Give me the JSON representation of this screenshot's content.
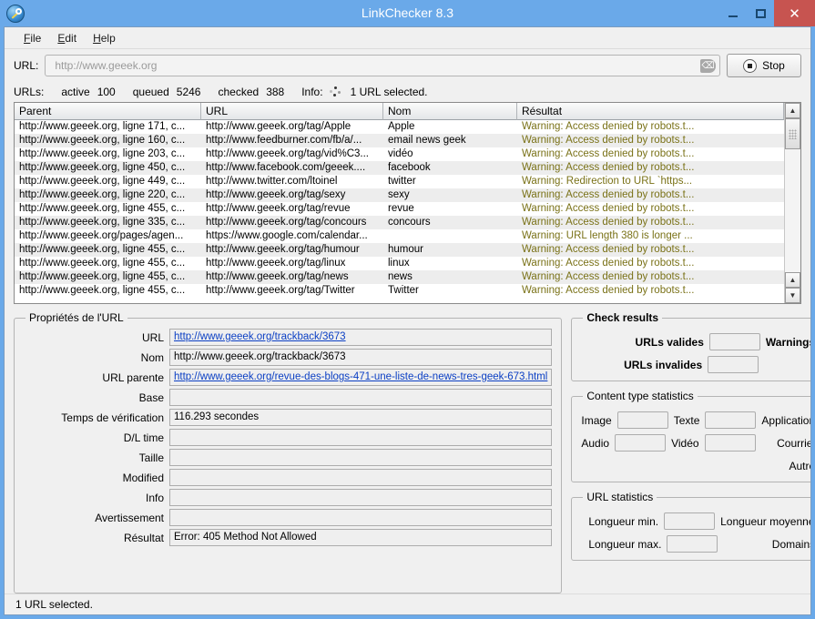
{
  "window": {
    "title": "LinkChecker 8.3",
    "app_icon": "linkchecker-icon",
    "minimize": "–",
    "maximize": "□",
    "close": "✕"
  },
  "menu": [
    {
      "pre": "",
      "mn": "F",
      "post": "ile"
    },
    {
      "pre": "",
      "mn": "E",
      "post": "dit"
    },
    {
      "pre": "",
      "mn": "H",
      "post": "elp"
    }
  ],
  "toolbar": {
    "url_label": "URL:",
    "url_value": "",
    "url_placeholder": "http://www.geeek.org",
    "clear_icon": "⌫",
    "stop_label": "Stop"
  },
  "counters": {
    "urls_label": "URLs:",
    "active_label": "active",
    "active_value": "100",
    "queued_label": "queued",
    "queued_value": "5246",
    "checked_label": "checked",
    "checked_value": "388",
    "info_label": "Info:",
    "info_value": "1 URL selected."
  },
  "table": {
    "columns": [
      "Parent",
      "URL",
      "Nom",
      "Résultat"
    ],
    "rows": [
      [
        "http://www.geeek.org, ligne 171, c...",
        "http://www.geeek.org/tag/Apple",
        "Apple",
        "Warning: Access denied by robots.t..."
      ],
      [
        "http://www.geeek.org, ligne 160, c...",
        "http://www.feedburner.com/fb/a/...",
        "email news geek",
        "Warning: Access denied by robots.t..."
      ],
      [
        "http://www.geeek.org, ligne 203, c...",
        "http://www.geeek.org/tag/vid%C3...",
        "vidéo",
        "Warning: Access denied by robots.t..."
      ],
      [
        "http://www.geeek.org, ligne 450, c...",
        "http://www.facebook.com/geeek....",
        "facebook",
        "Warning: Access denied by robots.t..."
      ],
      [
        "http://www.geeek.org, ligne 449, c...",
        "http://www.twitter.com/ltoinel",
        "twitter",
        "Warning: Redirection to URL `https..."
      ],
      [
        "http://www.geeek.org, ligne 220, c...",
        "http://www.geeek.org/tag/sexy",
        "sexy",
        "Warning: Access denied by robots.t..."
      ],
      [
        "http://www.geeek.org, ligne 455, c...",
        "http://www.geeek.org/tag/revue",
        "revue",
        "Warning: Access denied by robots.t..."
      ],
      [
        "http://www.geeek.org, ligne 335, c...",
        "http://www.geeek.org/tag/concours",
        "concours",
        "Warning: Access denied by robots.t..."
      ],
      [
        "http://www.geeek.org/pages/agen...",
        "https://www.google.com/calendar...",
        "",
        "Warning: URL length 380 is longer ..."
      ],
      [
        "http://www.geeek.org, ligne 455, c...",
        "http://www.geeek.org/tag/humour",
        "humour",
        "Warning: Access denied by robots.t..."
      ],
      [
        "http://www.geeek.org, ligne 455, c...",
        "http://www.geeek.org/tag/linux",
        "linux",
        "Warning: Access denied by robots.t..."
      ],
      [
        "http://www.geeek.org, ligne 455, c...",
        "http://www.geeek.org/tag/news",
        "news",
        "Warning: Access denied by robots.t..."
      ],
      [
        "http://www.geeek.org, ligne 455, c...",
        "http://www.geeek.org/tag/Twitter",
        "Twitter",
        "Warning: Access denied by robots.t..."
      ]
    ],
    "scroll_up_icon": "▲",
    "scroll_down_icon": "▼"
  },
  "properties": {
    "legend": "Propriétés de l'URL",
    "fields": [
      {
        "label": "URL",
        "value": "http://www.geeek.org/trackback/3673",
        "link": true
      },
      {
        "label": "Nom",
        "value": "http://www.geeek.org/trackback/3673",
        "link": false
      },
      {
        "label": "URL parente",
        "value": "http://www.geeek.org/revue-des-blogs-471-une-liste-de-news-tres-geek-673.html",
        "link": true
      },
      {
        "label": "Base",
        "value": "",
        "link": false
      },
      {
        "label": "Temps de vérification",
        "value": "116.293 secondes",
        "link": false
      },
      {
        "label": "D/L time",
        "value": "",
        "link": false
      },
      {
        "label": "Taille",
        "value": "",
        "link": false
      },
      {
        "label": "Modified",
        "value": "",
        "link": false
      },
      {
        "label": "Info",
        "value": "",
        "link": false
      },
      {
        "label": "Avertissement",
        "value": "",
        "link": false
      },
      {
        "label": "Résultat",
        "value": "Error: 405 Method Not Allowed",
        "link": false
      }
    ]
  },
  "check_results": {
    "legend": "Check results",
    "urls_valides_label": "URLs valides",
    "urls_valides_value": "",
    "warnings_label": "Warnings",
    "warnings_value": "",
    "urls_invalides_label": "URLs invalides",
    "urls_invalides_value": ""
  },
  "content_stats": {
    "legend": "Content type statistics",
    "image_label": "Image",
    "image_value": "",
    "texte_label": "Texte",
    "texte_value": "",
    "application_label": "Application",
    "application_value": "",
    "audio_label": "Audio",
    "audio_value": "",
    "video_label": "Vidéo",
    "video_value": "",
    "courriel_label": "Courriel",
    "courriel_value": "",
    "autre_label": "Autre",
    "autre_value": ""
  },
  "url_stats": {
    "legend": "URL statistics",
    "min_label": "Longueur min.",
    "min_value": "",
    "moyenne_label": "Longueur moyenne",
    "moyenne_value": "",
    "max_label": "Longueur max.",
    "max_value": "",
    "domains_label": "Domains",
    "domains_value": ""
  },
  "statusbar": {
    "text": "1 URL selected."
  }
}
